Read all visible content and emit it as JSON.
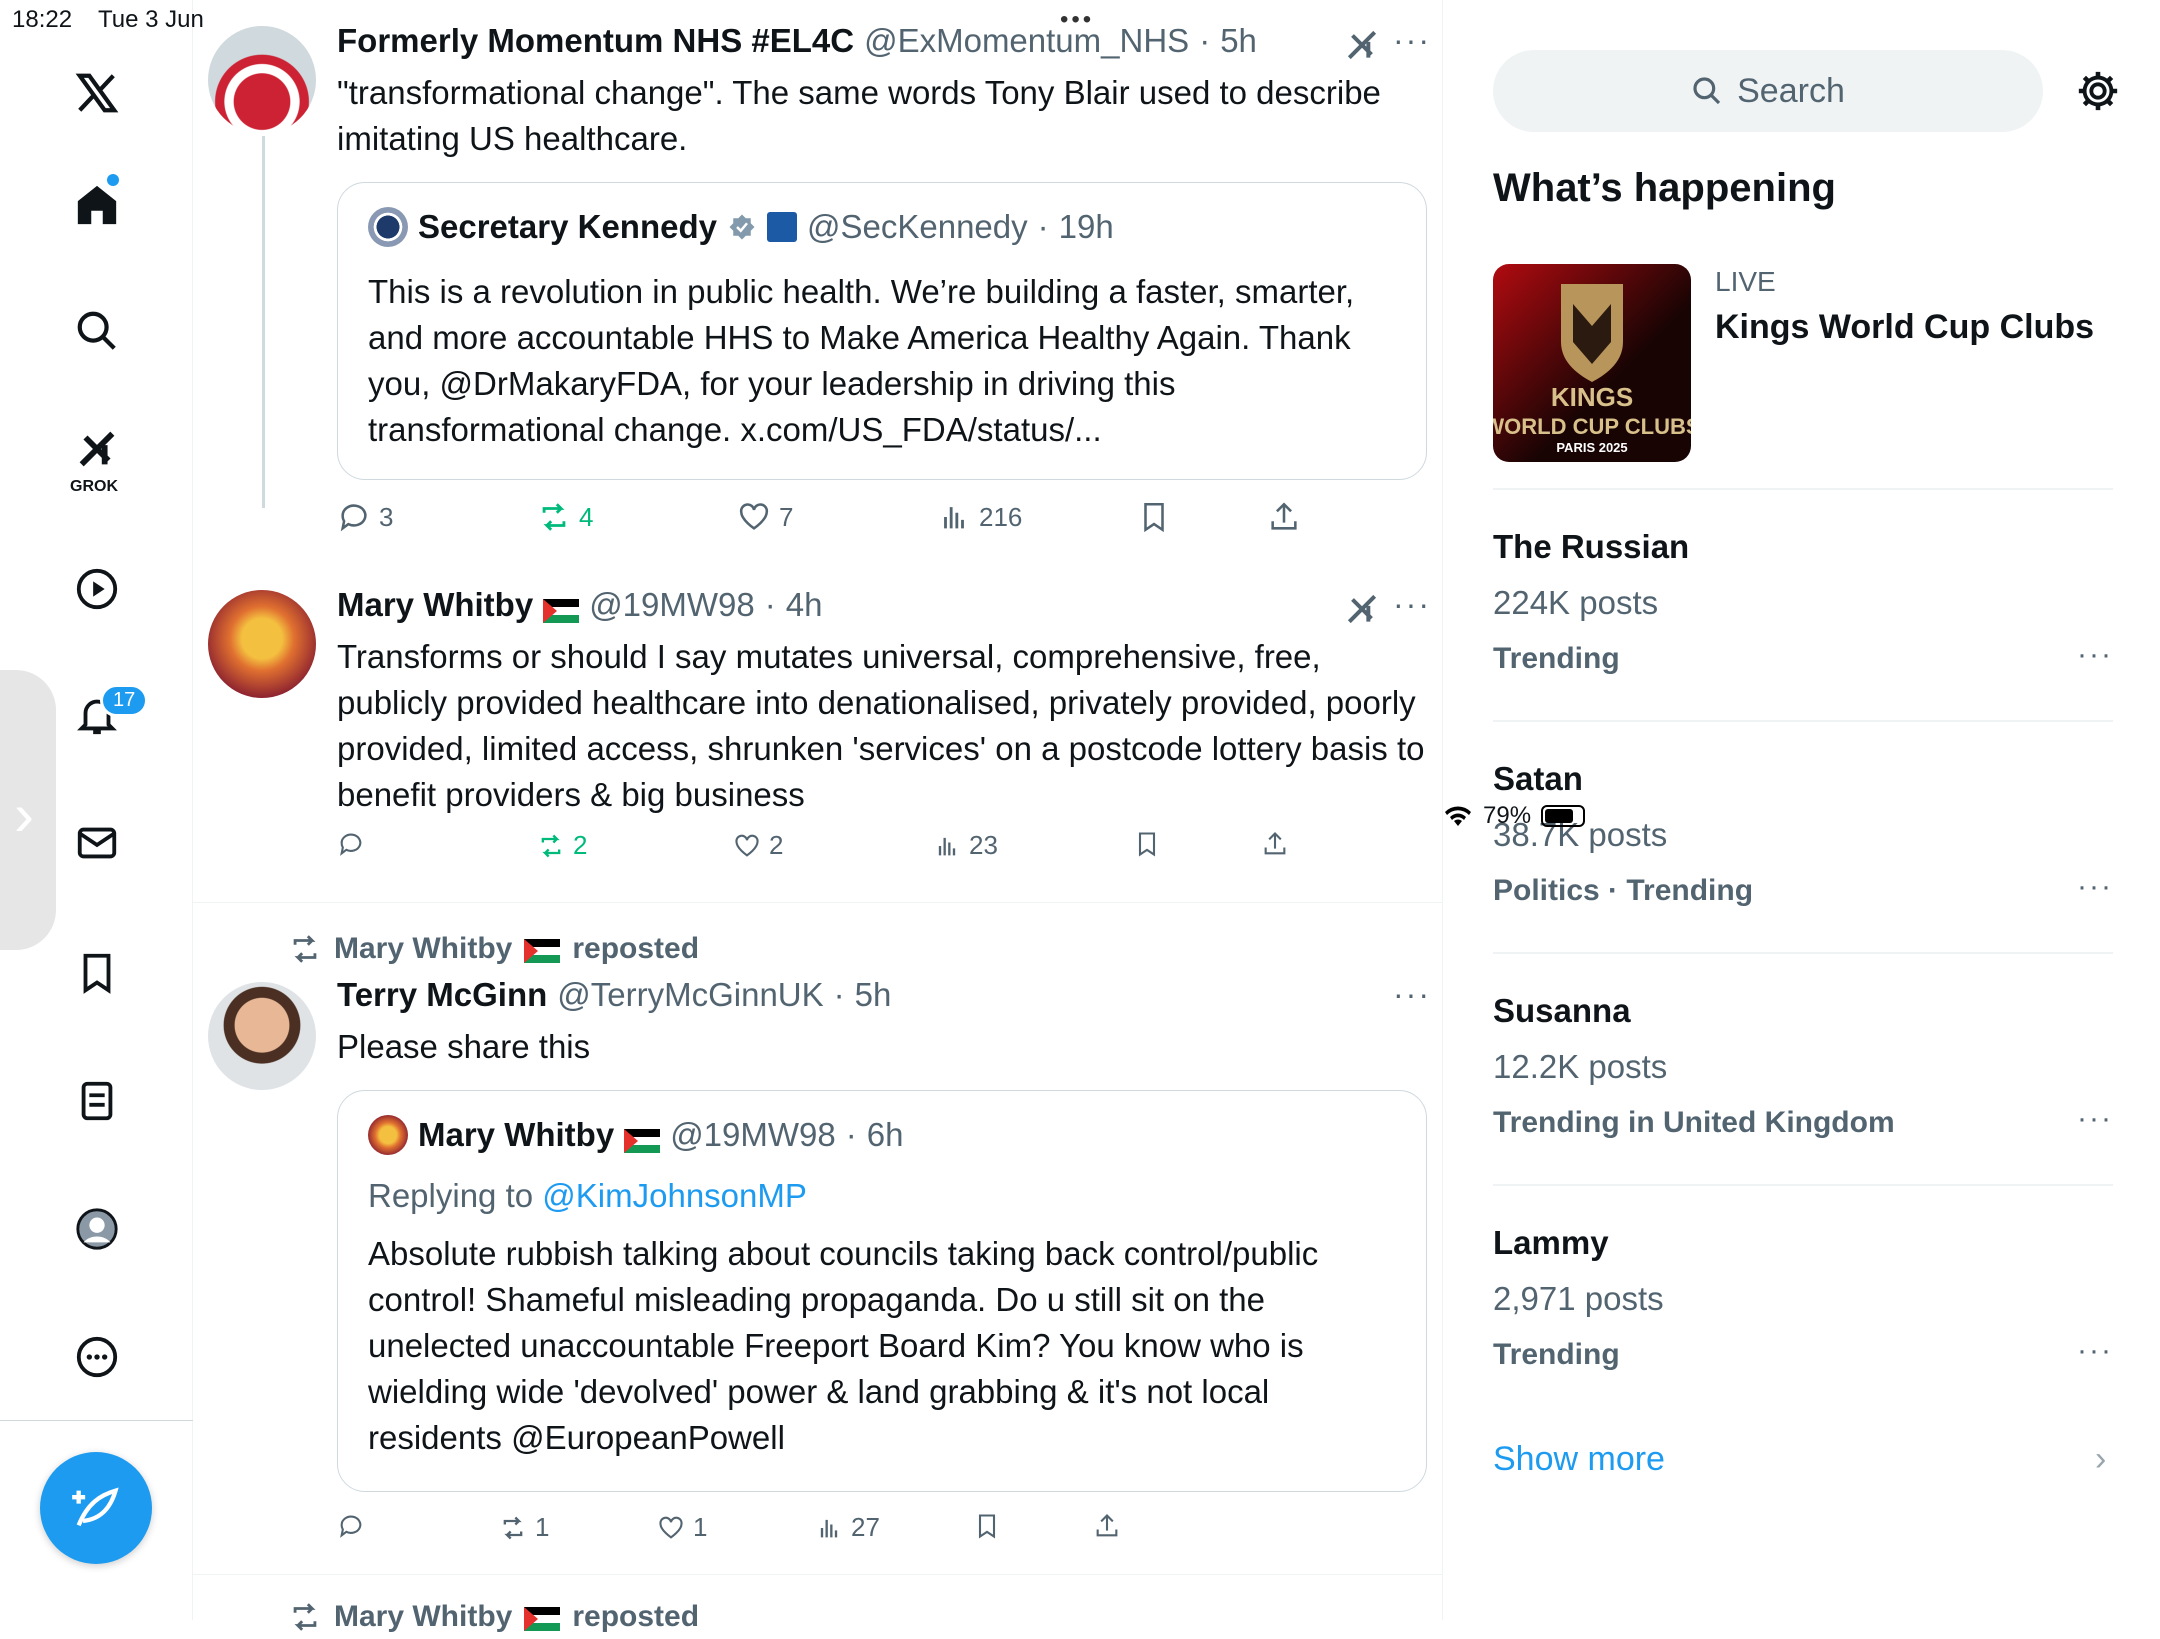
{
  "status": {
    "time": "18:22",
    "date": "Tue 3 Jun",
    "battery": "79%"
  },
  "nav": {
    "grok_label": "GROK",
    "notifications_count": "17"
  },
  "tweets": [
    {
      "name": "Formerly Momentum NHS #EL4C",
      "handle": "@ExMomentum_NHS",
      "time": "5h",
      "text": "\"transformational change\". The same words Tony Blair used to describe imitating US healthcare.",
      "quote": {
        "name": "Secretary Kennedy",
        "handle": "@SecKennedy",
        "time": "19h",
        "text": "This is a revolution in public health. We’re building a faster, smarter, and more accountable HHS to Make America Healthy Again. Thank you, @DrMakaryFDA, for your leadership in driving this transformational change. x.com/US_FDA/status/..."
      },
      "replies": "3",
      "reposts": "4",
      "likes": "7",
      "views": "216"
    },
    {
      "name": "Mary Whitby",
      "handle": "@19MW98",
      "time": "4h",
      "text": "Transforms or should I say mutates universal, comprehensive, free, publicly provided healthcare into denationalised, privately provided, poorly provided, limited access, shrunken 'services' on a postcode lottery basis to benefit providers & big business",
      "replies": "",
      "reposts": "2",
      "likes": "2",
      "views": "23"
    },
    {
      "repost_by": "Mary Whitby",
      "repost_suffix": "reposted",
      "name": "Terry McGinn",
      "handle": "@TerryMcGinnUK",
      "time": "5h",
      "text": "Please share this",
      "quote": {
        "name": "Mary Whitby",
        "handle": "@19MW98",
        "time": "6h",
        "replying_prefix": "Replying to",
        "replying_to": "@KimJohnsonMP",
        "text": "Absolute rubbish talking about councils taking back control/public control! Shameful misleading propaganda. Do u still sit on the unelected unaccountable Freeport Board Kim? You know who is wielding wide 'devolved' power & land grabbing & it's not local residents @EuropeanPowell"
      },
      "replies": "",
      "reposts": "1",
      "likes": "1",
      "views": "27"
    },
    {
      "repost_by": "Mary Whitby",
      "repost_suffix": "reposted"
    }
  ],
  "sidebar": {
    "search_placeholder": "Search",
    "title": "What’s happening",
    "live": {
      "label": "LIVE",
      "title": "Kings World Cup Clubs",
      "img_line1": "KINGS",
      "img_line2": "WORLD CUP CLUBS",
      "img_line3": "PARIS 2025"
    },
    "trends": [
      {
        "name": "The Russian",
        "posts": "224K posts",
        "category": "Trending"
      },
      {
        "name": "Satan",
        "posts": "38.7K posts",
        "category": "Politics · Trending"
      },
      {
        "name": "Susanna",
        "posts": "12.2K posts",
        "category": "Trending in United Kingdom"
      },
      {
        "name": "Lammy",
        "posts": "2,971 posts",
        "category": "Trending"
      }
    ],
    "show_more": "Show more"
  }
}
